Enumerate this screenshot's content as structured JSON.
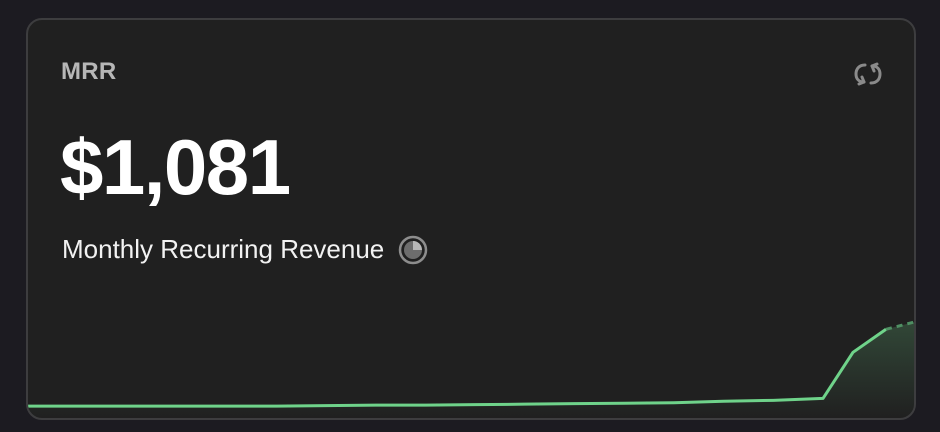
{
  "card": {
    "label": "MRR",
    "value": "$1,081",
    "subtitle": "Monthly Recurring Revenue",
    "icons": {
      "refresh": "refresh-icon",
      "info": "clock-pie-icon"
    }
  },
  "colors": {
    "background": "#1c1b21",
    "card": "#202020",
    "border": "#3d3d3f",
    "line": "#6fd38a"
  },
  "chart_data": {
    "type": "line",
    "title": "",
    "xlabel": "",
    "ylabel": "",
    "series": [
      {
        "values": [
          0.02,
          0.02,
          0.02,
          0.02,
          0.02,
          0.02,
          0.025,
          0.03,
          0.03,
          0.035,
          0.04,
          0.045,
          0.05,
          0.055,
          0.07,
          0.08,
          0.1,
          0.58,
          0.82
        ],
        "projected_values": [
          0.82,
          0.9
        ]
      }
    ],
    "grid": false,
    "legend": "none"
  }
}
